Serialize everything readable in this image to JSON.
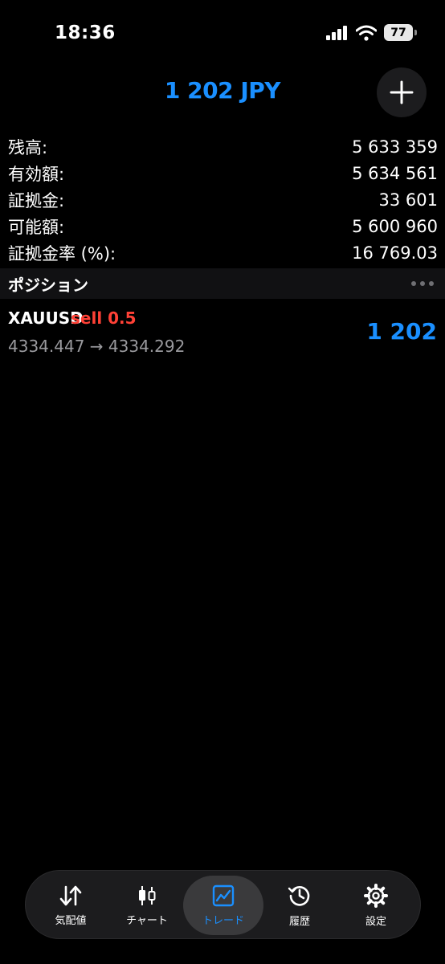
{
  "status_bar": {
    "time": "18:36",
    "battery": "77"
  },
  "header": {
    "total_profit": "1 202 JPY",
    "add_icon": "plus-icon"
  },
  "account": [
    {
      "label": "残高:",
      "value": "5 633 359"
    },
    {
      "label": "有効額:",
      "value": "5 634 561"
    },
    {
      "label": "証拠金:",
      "value": "33 601"
    },
    {
      "label": "可能額:",
      "value": "5 600 960"
    },
    {
      "label": "証拠金率 (%):",
      "value": "16 769.03"
    }
  ],
  "positions_section": {
    "title": "ポジション",
    "menu_icon": "more-dots-icon"
  },
  "positions": [
    {
      "symbol": "XAUUSD",
      "type": "sell 0.5",
      "prices": "4334.447 → 4334.292",
      "profit": "1 202"
    }
  ],
  "tabs": [
    {
      "label": "気配値",
      "icon": "quotes-arrows-icon"
    },
    {
      "label": "チャート",
      "icon": "candlestick-chart-icon"
    },
    {
      "label": "トレード",
      "icon": "trade-chart-icon",
      "active": true
    },
    {
      "label": "履歴",
      "icon": "history-clock-icon"
    },
    {
      "label": "設定",
      "icon": "gear-icon"
    }
  ],
  "colors": {
    "accent": "#1a8fff",
    "sell": "#ff4136",
    "background": "#000000"
  }
}
